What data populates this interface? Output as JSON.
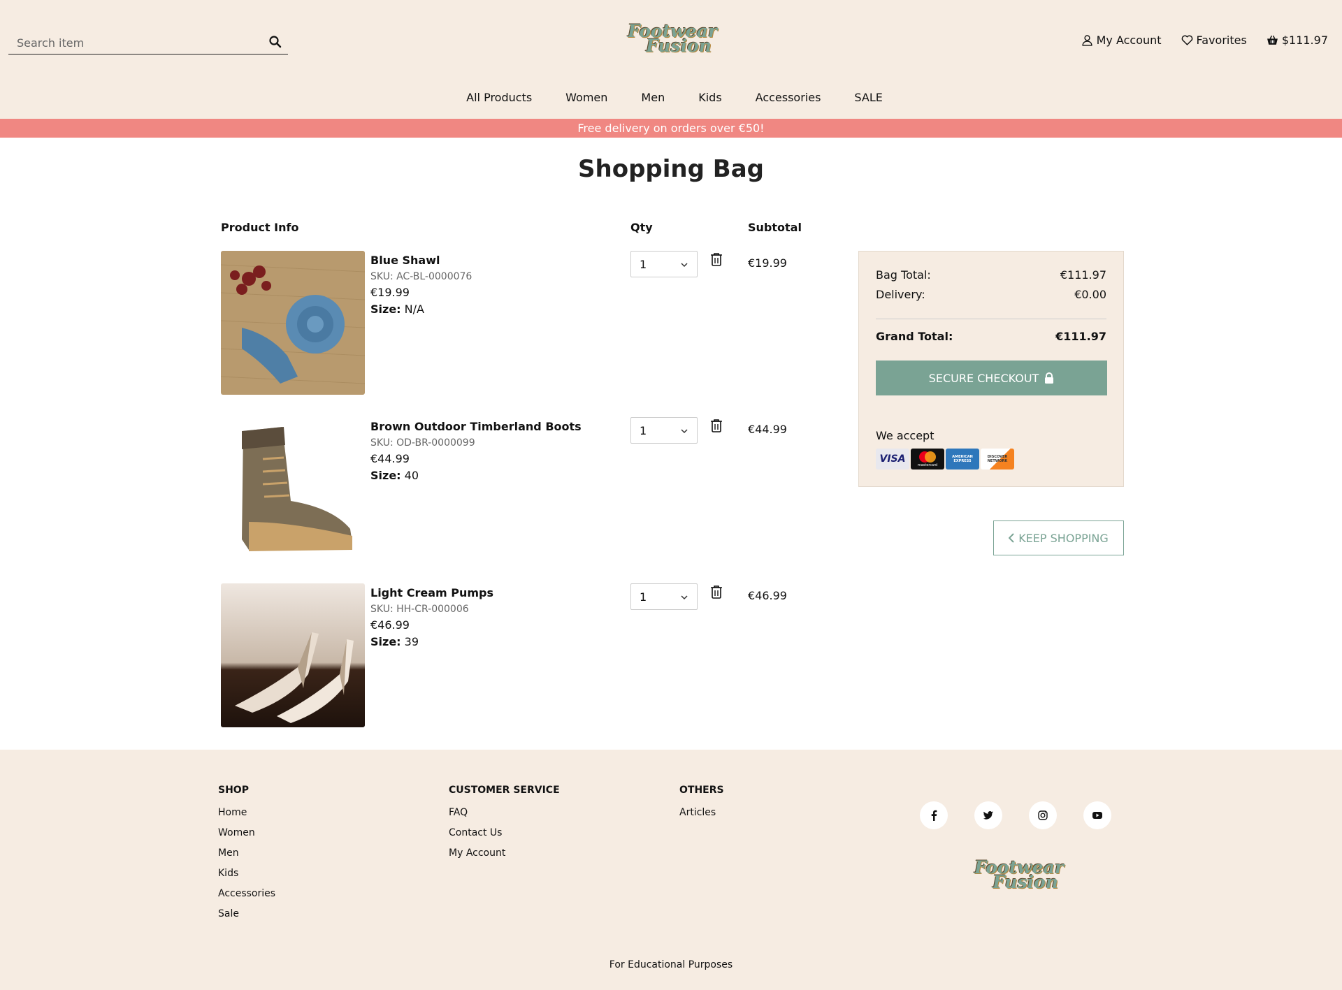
{
  "header": {
    "search_placeholder": "Search item",
    "logo_line1": "Footwear",
    "logo_line2": "Fusion",
    "my_account": "My Account",
    "favorites": "Favorites",
    "bag_total": "$111.97"
  },
  "nav": [
    "All Products",
    "Women",
    "Men",
    "Kids",
    "Accessories",
    "SALE"
  ],
  "banner": "Free delivery on orders over €50!",
  "page_title": "Shopping Bag",
  "columns": {
    "product_info": "Product Info",
    "qty": "Qty",
    "subtotal": "Subtotal"
  },
  "items": [
    {
      "name": "Blue Shawl",
      "sku": "SKU: AC-BL-0000076",
      "price": "€19.99",
      "size_label": "Size:",
      "size": "N/A",
      "qty": "1",
      "subtotal": "€19.99"
    },
    {
      "name": "Brown Outdoor Timberland Boots",
      "sku": "SKU: OD-BR-0000099",
      "price": "€44.99",
      "size_label": "Size:",
      "size": "40",
      "qty": "1",
      "subtotal": "€44.99"
    },
    {
      "name": "Light Cream Pumps",
      "sku": "SKU: HH-CR-000006",
      "price": "€46.99",
      "size_label": "Size:",
      "size": "39",
      "qty": "1",
      "subtotal": "€46.99"
    }
  ],
  "summary": {
    "bag_total_label": "Bag Total:",
    "bag_total": "€111.97",
    "delivery_label": "Delivery:",
    "delivery": "€0.00",
    "grand_total_label": "Grand Total:",
    "grand_total": "€111.97",
    "checkout_label": "SECURE CHECKOUT",
    "we_accept": "We accept",
    "cards": [
      "VISA",
      "mastercard",
      "AMERICAN EXPRESS",
      "DISCOVER NETWORK"
    ]
  },
  "keep_shopping": "KEEP SHOPPING",
  "footer": {
    "shop_heading": "SHOP",
    "shop_links": [
      "Home",
      "Women",
      "Men",
      "Kids",
      "Accessories",
      "Sale"
    ],
    "service_heading": "CUSTOMER SERVICE",
    "service_links": [
      "FAQ",
      "Contact Us",
      "My Account"
    ],
    "others_heading": "OTHERS",
    "others_links": [
      "Articles"
    ],
    "social": [
      "facebook-icon",
      "twitter-icon",
      "instagram-icon",
      "youtube-icon"
    ],
    "educational": "For Educational Purposes"
  },
  "colors": {
    "header_bg": "#f6ece2",
    "banner_bg": "#f08782",
    "accent": "#7aa394"
  }
}
